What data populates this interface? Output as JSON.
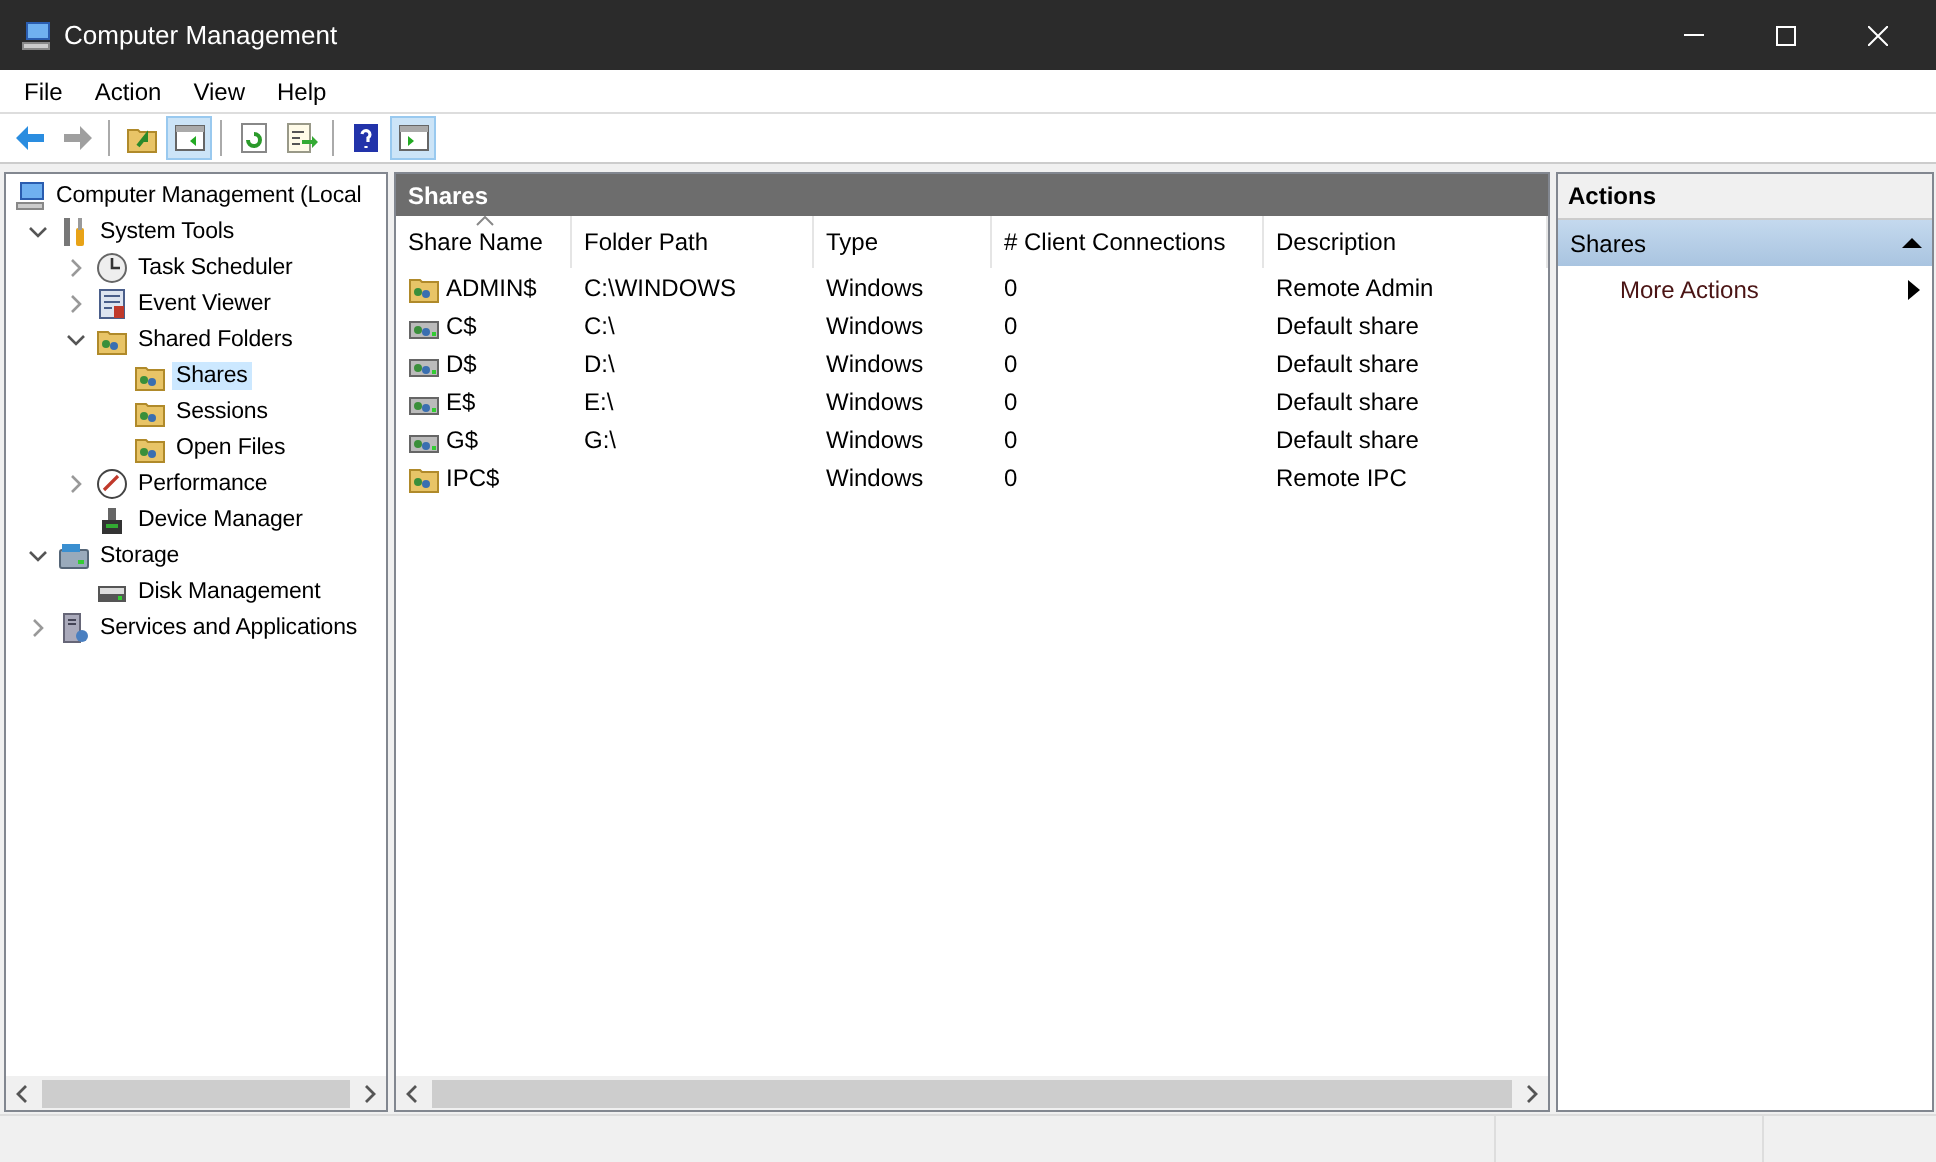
{
  "window": {
    "title": "Computer Management"
  },
  "menu": [
    "File",
    "Action",
    "View",
    "Help"
  ],
  "toolbar": [
    {
      "kind": "back",
      "disabled": false,
      "pressed": false
    },
    {
      "kind": "forward",
      "disabled": true,
      "pressed": false
    },
    {
      "kind": "separator"
    },
    {
      "kind": "up",
      "disabled": false,
      "pressed": false
    },
    {
      "kind": "tree-pane",
      "disabled": false,
      "pressed": true
    },
    {
      "kind": "separator"
    },
    {
      "kind": "refresh",
      "disabled": false,
      "pressed": false
    },
    {
      "kind": "export",
      "disabled": false,
      "pressed": false
    },
    {
      "kind": "separator"
    },
    {
      "kind": "help",
      "disabled": false,
      "pressed": false
    },
    {
      "kind": "action-pane",
      "disabled": false,
      "pressed": true
    }
  ],
  "tree": [
    {
      "label": "Computer Management (Local",
      "kind": "computer",
      "selected": false,
      "children": [
        {
          "label": "System Tools",
          "kind": "tools",
          "expanded": true,
          "selected": false,
          "children": [
            {
              "label": "Task Scheduler",
              "kind": "clock",
              "expanded": false,
              "selected": false
            },
            {
              "label": "Event Viewer",
              "kind": "log",
              "expanded": false,
              "selected": false
            },
            {
              "label": "Shared Folders",
              "kind": "share",
              "expanded": true,
              "selected": false,
              "children": [
                {
                  "label": "Shares",
                  "kind": "share",
                  "selected": true
                },
                {
                  "label": "Sessions",
                  "kind": "share",
                  "selected": false
                },
                {
                  "label": "Open Files",
                  "kind": "share",
                  "selected": false
                }
              ]
            },
            {
              "label": "Performance",
              "kind": "gauge",
              "expanded": false,
              "selected": false
            },
            {
              "label": "Device Manager",
              "kind": "device",
              "selected": false
            }
          ]
        },
        {
          "label": "Storage",
          "kind": "storage",
          "expanded": true,
          "selected": false,
          "children": [
            {
              "label": "Disk Management",
              "kind": "disk",
              "selected": false
            }
          ]
        },
        {
          "label": "Services and Applications",
          "kind": "services",
          "expanded": false,
          "selected": false
        }
      ]
    }
  ],
  "list": {
    "title": "Shares",
    "columns": [
      {
        "label": "Share Name",
        "sorted": true
      },
      {
        "label": "Folder Path",
        "sorted": false
      },
      {
        "label": "Type",
        "sorted": false
      },
      {
        "label": "# Client Connections",
        "sorted": false
      },
      {
        "label": "Description",
        "sorted": false
      }
    ],
    "rows": [
      {
        "kind": "folder",
        "selected": false,
        "cells": [
          "ADMIN$",
          "C:\\WINDOWS",
          "Windows",
          "0",
          "Remote Admin"
        ]
      },
      {
        "kind": "drive",
        "selected": false,
        "cells": [
          "C$",
          "C:\\",
          "Windows",
          "0",
          "Default share"
        ]
      },
      {
        "kind": "drive",
        "selected": false,
        "cells": [
          "D$",
          "D:\\",
          "Windows",
          "0",
          "Default share"
        ]
      },
      {
        "kind": "drive",
        "selected": false,
        "cells": [
          "E$",
          "E:\\",
          "Windows",
          "0",
          "Default share"
        ]
      },
      {
        "kind": "drive",
        "selected": false,
        "cells": [
          "G$",
          "G:\\",
          "Windows",
          "0",
          "Default share"
        ]
      },
      {
        "kind": "folder",
        "selected": false,
        "cells": [
          "IPC$",
          "",
          "Windows",
          "0",
          "Remote IPC"
        ]
      }
    ]
  },
  "actions": {
    "title": "Actions",
    "sections": [
      {
        "label": "Shares",
        "expanded": true,
        "items": [
          {
            "label": "More Actions",
            "submenu": true
          }
        ]
      }
    ]
  }
}
